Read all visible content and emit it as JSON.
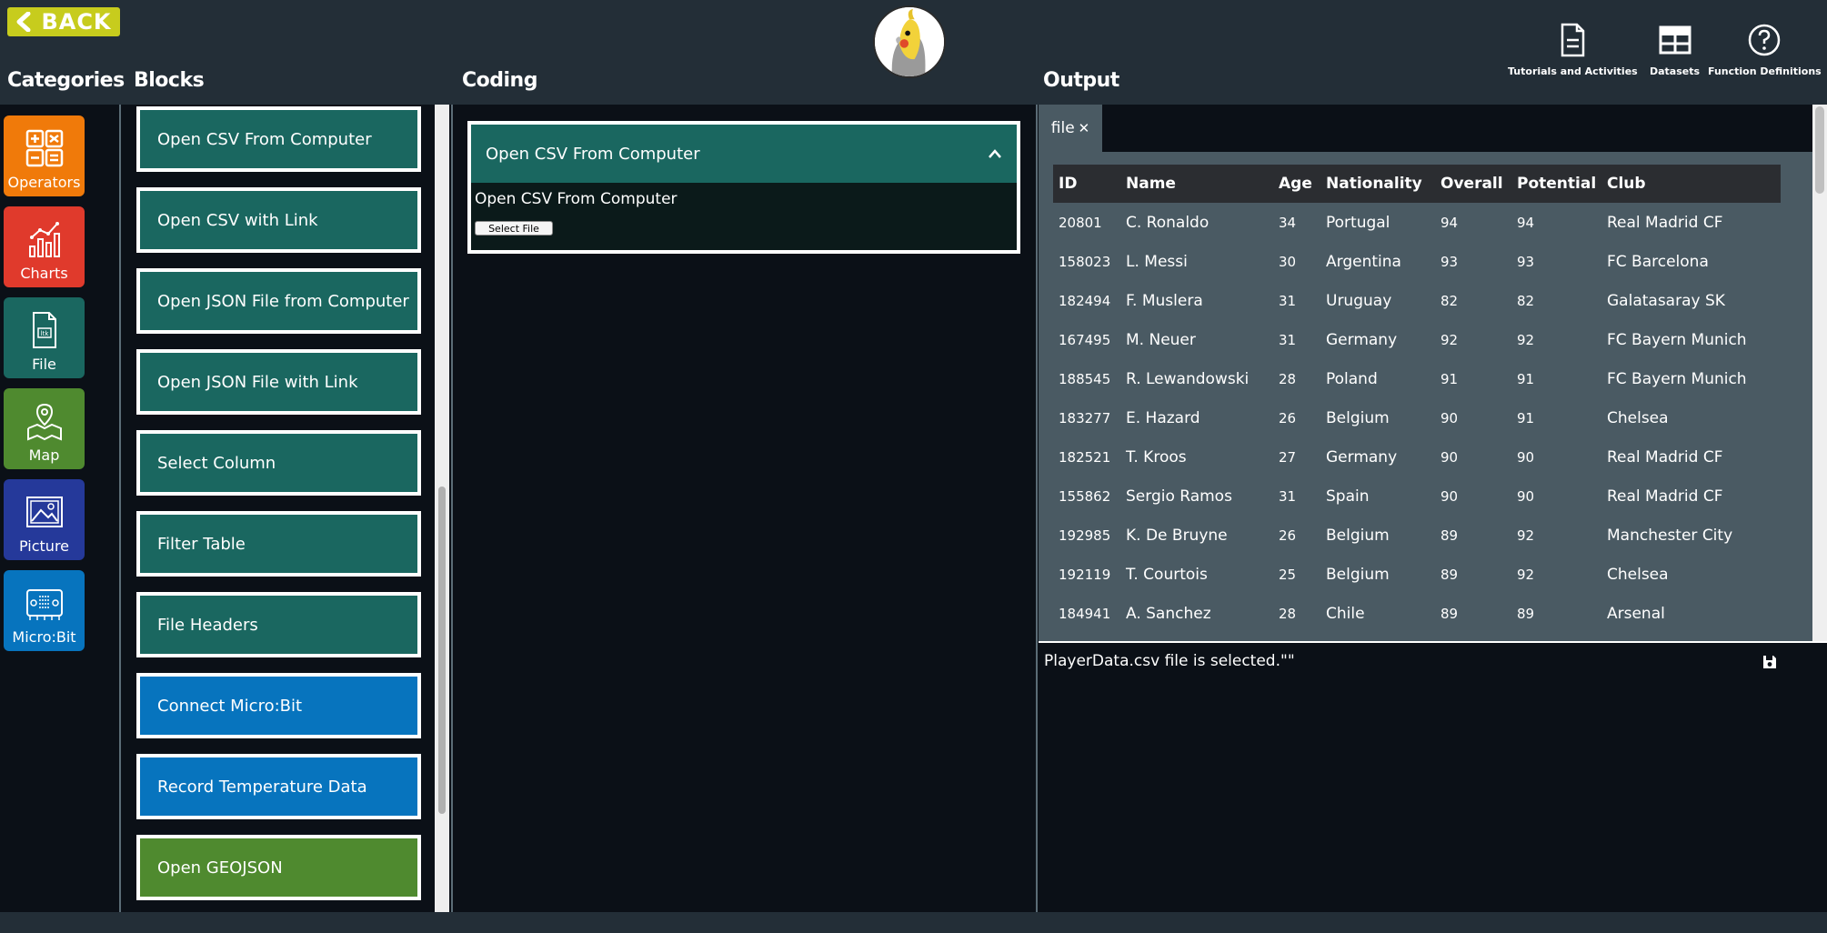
{
  "header": {
    "back_label": "BACK",
    "section_titles": {
      "categories": "Categories",
      "blocks": "Blocks",
      "coding": "Coding",
      "output": "Output"
    },
    "tools": [
      {
        "label": "Tutorials and Activities",
        "icon": "document-icon"
      },
      {
        "label": "Datasets",
        "icon": "table-icon"
      },
      {
        "label": "Function Definitions",
        "icon": "help-circle-icon"
      }
    ],
    "logo": "cockatiel-logo"
  },
  "categories": [
    {
      "label": "Operators",
      "color": "#f07a0a",
      "icon": "operators-icon"
    },
    {
      "label": "Charts",
      "color": "#e03a2c",
      "icon": "chart-icon"
    },
    {
      "label": "File",
      "color": "#1a6760",
      "icon": "file-icon"
    },
    {
      "label": "Map",
      "color": "#4f8a2f",
      "icon": "map-icon"
    },
    {
      "label": "Picture",
      "color": "#25399a",
      "icon": "picture-icon"
    },
    {
      "label": "Micro:Bit",
      "color": "#0774be",
      "icon": "microbit-icon"
    }
  ],
  "blocks": [
    {
      "label": "Open CSV From Computer",
      "color": "#1a6760"
    },
    {
      "label": "Open CSV with Link",
      "color": "#1a6760"
    },
    {
      "label": "Open JSON File from Computer",
      "color": "#1a6760"
    },
    {
      "label": "Open JSON File with Link",
      "color": "#1a6760"
    },
    {
      "label": "Select Column",
      "color": "#1a6760"
    },
    {
      "label": "Filter Table",
      "color": "#1a6760"
    },
    {
      "label": "File Headers",
      "color": "#1a6760"
    },
    {
      "label": "Connect Micro:Bit",
      "color": "#0774be"
    },
    {
      "label": "Record Temperature Data",
      "color": "#0774be"
    },
    {
      "label": "Open GEOJSON",
      "color": "#4f8a2f"
    }
  ],
  "coding": {
    "block_title": "Open CSV From Computer",
    "block_sub": "Open CSV From Computer",
    "select_file_label": "Select File"
  },
  "output": {
    "tab_label": "file",
    "columns": [
      "ID",
      "Name",
      "Age",
      "Nationality",
      "Overall",
      "Potential",
      "Club"
    ],
    "rows": [
      [
        "20801",
        "C. Ronaldo",
        "34",
        "Portugal",
        "94",
        "94",
        "Real Madrid CF"
      ],
      [
        "158023",
        "L. Messi",
        "30",
        "Argentina",
        "93",
        "93",
        "FC Barcelona"
      ],
      [
        "182494",
        "F. Muslera",
        "31",
        "Uruguay",
        "82",
        "82",
        "Galatasaray SK"
      ],
      [
        "167495",
        "M. Neuer",
        "31",
        "Germany",
        "92",
        "92",
        "FC Bayern Munich"
      ],
      [
        "188545",
        "R. Lewandowski",
        "28",
        "Poland",
        "91",
        "91",
        "FC Bayern Munich"
      ],
      [
        "183277",
        "E. Hazard",
        "26",
        "Belgium",
        "90",
        "91",
        "Chelsea"
      ],
      [
        "182521",
        "T. Kroos",
        "27",
        "Germany",
        "90",
        "90",
        "Real Madrid CF"
      ],
      [
        "155862",
        "Sergio Ramos",
        "31",
        "Spain",
        "90",
        "90",
        "Real Madrid CF"
      ],
      [
        "192985",
        "K. De Bruyne",
        "26",
        "Belgium",
        "89",
        "92",
        "Manchester City"
      ],
      [
        "192119",
        "T. Courtois",
        "25",
        "Belgium",
        "89",
        "92",
        "Chelsea"
      ],
      [
        "184941",
        "A. Sanchez",
        "28",
        "Chile",
        "89",
        "89",
        "Arsenal"
      ]
    ],
    "console_message": "PlayerData.csv file is selected.\"\""
  }
}
